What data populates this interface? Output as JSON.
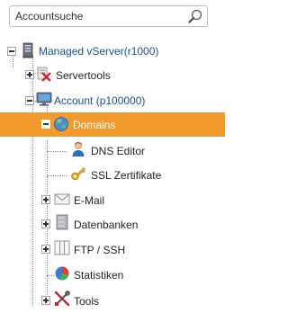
{
  "search": {
    "placeholder": "Accountsuche",
    "value": "",
    "icon": "magnifier-icon"
  },
  "tree": {
    "root": {
      "label": "Managed vServer(r1000)",
      "icon": "server-icon",
      "expanded": true
    },
    "servertools": {
      "label": "Servertools",
      "icon": "tools-x-icon",
      "expanded": false
    },
    "account": {
      "label": "Account (p100000)",
      "icon": "monitor-icon",
      "expanded": true
    },
    "domains": {
      "label": "Domains",
      "icon": "globe-icon",
      "expanded": true,
      "selected": true
    },
    "dns_editor": {
      "label": "DNS Editor",
      "icon": "person-icon"
    },
    "ssl": {
      "label": "SSL Zertifikate",
      "icon": "key-icon"
    },
    "email": {
      "label": "E-Mail",
      "icon": "envelope-icon",
      "expanded": false
    },
    "datenbanken": {
      "label": "Datenbanken",
      "icon": "database-icon",
      "expanded": false
    },
    "ftp_ssh": {
      "label": "FTP / SSH",
      "icon": "pages-icon",
      "expanded": false
    },
    "statistiken": {
      "label": "Statistiken",
      "icon": "pie-chart-icon"
    },
    "tools": {
      "label": "Tools",
      "icon": "tools-icon",
      "expanded": false
    }
  },
  "colors": {
    "selected_bg": "#f39a2d",
    "link_blue": "#1d4f91"
  }
}
